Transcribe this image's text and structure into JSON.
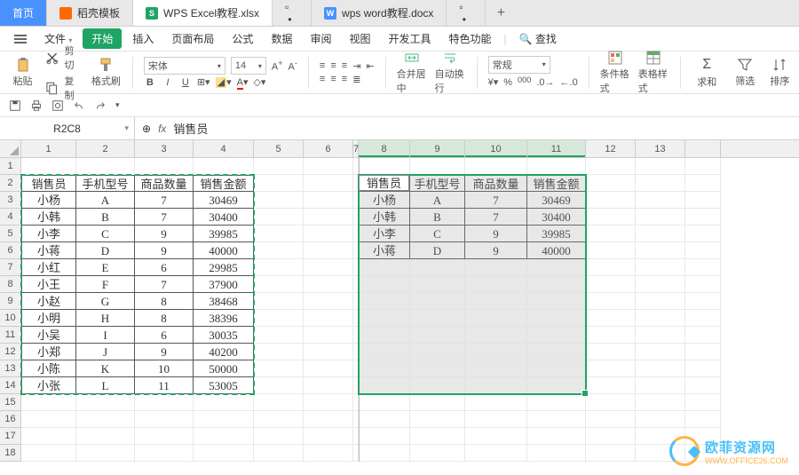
{
  "tabs": {
    "home": "首页",
    "dao": "稻壳模板",
    "excel": "WPS Excel教程.xlsx",
    "word": "wps word教程.docx"
  },
  "menu": {
    "file": "文件",
    "start": "开始",
    "insert": "插入",
    "layout": "页面布局",
    "formula": "公式",
    "data": "数据",
    "review": "审阅",
    "view": "视图",
    "dev": "开发工具",
    "special": "特色功能",
    "search": "查找"
  },
  "ribbon": {
    "paste": "粘贴",
    "cut": "剪切",
    "copy": "复制",
    "format_painter": "格式刷",
    "font_name": "宋体",
    "font_size": "14",
    "merge": "合并居中",
    "wrap": "自动换行",
    "number_fmt": "常规",
    "cond_fmt": "条件格式",
    "table_style": "表格样式",
    "sum": "求和",
    "filter": "筛选",
    "sort": "排序"
  },
  "name_box": "R2C8",
  "formula_value": "销售员",
  "col_headers": [
    "1",
    "2",
    "3",
    "4",
    "5",
    "6",
    "7",
    "8",
    "9",
    "10",
    "11",
    "12",
    "13",
    ""
  ],
  "row_headers": [
    "1",
    "2",
    "3",
    "4",
    "5",
    "6",
    "7",
    "8",
    "9",
    "10",
    "11",
    "12",
    "13",
    "14",
    "15",
    "16",
    "17",
    "18"
  ],
  "table_left": {
    "headers": [
      "销售员",
      "手机型号",
      "商品数量",
      "销售金额"
    ],
    "rows": [
      [
        "小杨",
        "A",
        "7",
        "30469"
      ],
      [
        "小韩",
        "B",
        "7",
        "30400"
      ],
      [
        "小李",
        "C",
        "9",
        "39985"
      ],
      [
        "小蒋",
        "D",
        "9",
        "40000"
      ],
      [
        "小红",
        "E",
        "6",
        "29985"
      ],
      [
        "小王",
        "F",
        "7",
        "37900"
      ],
      [
        "小赵",
        "G",
        "8",
        "38468"
      ],
      [
        "小明",
        "H",
        "8",
        "38396"
      ],
      [
        "小吴",
        "I",
        "6",
        "30035"
      ],
      [
        "小郑",
        "J",
        "9",
        "40200"
      ],
      [
        "小陈",
        "K",
        "10",
        "50000"
      ],
      [
        "小张",
        "L",
        "11",
        "53005"
      ]
    ]
  },
  "table_right": {
    "headers": [
      "销售员",
      "手机型号",
      "商品数量",
      "销售金额"
    ],
    "rows": [
      [
        "小杨",
        "A",
        "7",
        "30469"
      ],
      [
        "小韩",
        "B",
        "7",
        "30400"
      ],
      [
        "小李",
        "C",
        "9",
        "39985"
      ],
      [
        "小蒋",
        "D",
        "9",
        "40000"
      ]
    ]
  },
  "watermark": {
    "cn": "欧菲资源网",
    "en": "WWW.OFFICE26.COM"
  }
}
